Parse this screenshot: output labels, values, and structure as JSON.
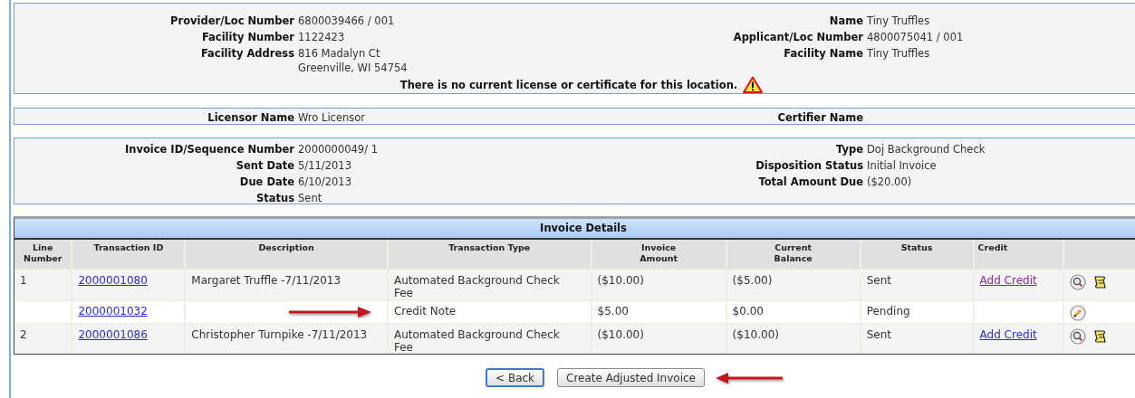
{
  "provider_panel": {
    "left": [
      {
        "label": "Provider/Loc Number",
        "value": [
          "6800039466 / 001"
        ]
      },
      {
        "label": "Facility Number",
        "value": [
          "1122423"
        ]
      },
      {
        "label": "Facility Address",
        "value": [
          "816 Madalyn Ct",
          "Greenville, WI 54754"
        ]
      }
    ],
    "right": [
      {
        "label": "Name",
        "value": [
          "Tiny Truffles"
        ]
      },
      {
        "label": "Applicant/Loc Number",
        "value": [
          "4800075041 / 001"
        ]
      },
      {
        "label": "Facility Name",
        "value": [
          "Tiny Truffles"
        ]
      }
    ],
    "warning": "There is no current license or certificate for this location."
  },
  "licensor_panel": {
    "left": [
      {
        "label": "Licensor Name",
        "value": [
          "Wro Licensor"
        ]
      }
    ],
    "right": [
      {
        "label": "Certifier Name"
      }
    ]
  },
  "invoice_panel": {
    "left": [
      {
        "label": "Invoice ID/Sequence Number",
        "value": [
          "2000000049/ 1"
        ]
      },
      {
        "label": "Sent Date",
        "value": [
          "5/11/2013"
        ]
      },
      {
        "label": "Due Date",
        "value": [
          "6/10/2013"
        ]
      },
      {
        "label": "Status",
        "value": [
          "Sent"
        ]
      }
    ],
    "right": [
      {
        "label": "Type",
        "value": [
          "Doj Background Check"
        ]
      },
      {
        "label": "Disposition Status",
        "value": [
          "Initial Invoice"
        ]
      },
      {
        "label": "Total Amount Due",
        "value": [
          "($20.00)"
        ]
      }
    ]
  },
  "invoice_details": {
    "title": "Invoice Details",
    "columns": [
      "Line Number",
      "Transaction ID",
      "Description",
      "Transaction Type",
      "Invoice Amount",
      "Current Balance",
      "Status",
      "Credit"
    ],
    "rows": [
      {
        "line": "1",
        "transaction_id": "2000001080",
        "description": "Margaret Truffle -7/11/2013",
        "type": "Automated Background Check Fee",
        "invoice_amount": "($10.00)",
        "current_balance": "($5.00)",
        "status": "Sent",
        "credit": {
          "label": "Add Credit",
          "visited": true
        },
        "arrow": false,
        "actions": [
          {
            "kind": "view"
          },
          {
            "kind": "notes"
          }
        ]
      },
      {
        "line": "",
        "transaction_id": "2000001032",
        "description": "",
        "type": "Credit Note",
        "invoice_amount": "$5.00",
        "current_balance": "$0.00",
        "status": "Pending",
        "arrow": true,
        "actions": [
          {
            "kind": "edit"
          }
        ]
      },
      {
        "line": "2",
        "transaction_id": "2000001086",
        "description": "Christopher Turnpike -7/11/2013",
        "type": "Automated Background Check Fee",
        "invoice_amount": "($10.00)",
        "current_balance": "($10.00)",
        "status": "Sent",
        "credit": {
          "label": "Add Credit",
          "visited": false
        },
        "arrow": false,
        "actions": [
          {
            "kind": "view"
          },
          {
            "kind": "notes"
          }
        ]
      }
    ]
  },
  "buttons": [
    {
      "label": "< Back",
      "default": true,
      "arrow": false
    },
    {
      "label": "Create Adjusted Invoice",
      "default": false,
      "arrow": true
    }
  ]
}
